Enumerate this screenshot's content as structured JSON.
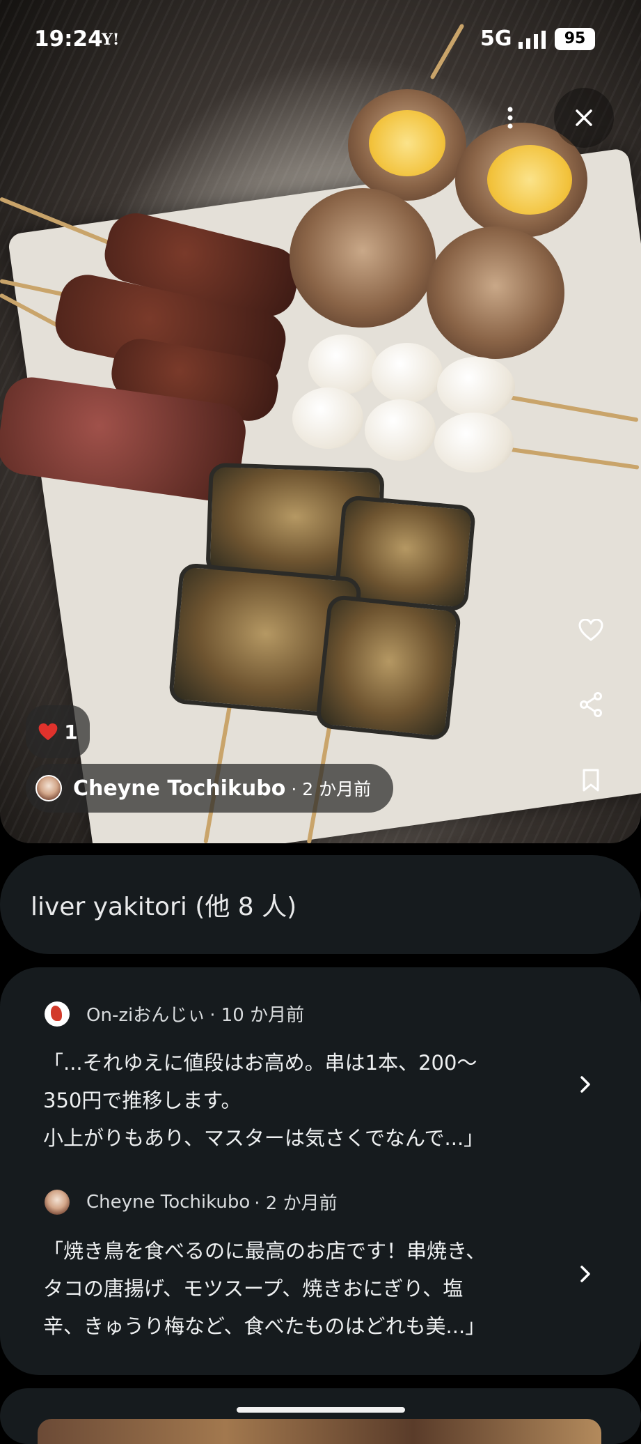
{
  "status_bar": {
    "time": "19:24",
    "carrier_icon": "Y!",
    "network": "5G",
    "battery": "95"
  },
  "photo": {
    "description_icon": "photo-of-yakitori",
    "like_count": "1",
    "author_name": "Cheyne Tochikubo",
    "author_meta": "· 2 か月前",
    "buttons": [
      "more-icon",
      "close-icon",
      "heart-icon",
      "share-icon",
      "bookmark-icon"
    ]
  },
  "caption": {
    "text": "liver yakitori (他 8 人)"
  },
  "reviews": [
    {
      "author": "On-ziおんじぃ",
      "meta": "· 10 か月前",
      "text": "「...それゆえに値段はお高め。串は1本、200〜\n350円で推移します。\n小上がりもあり、マスターは気さくでなんで...」"
    },
    {
      "author": "Cheyne Tochikubo",
      "meta": "· 2 か月前",
      "text": "「焼き鳥を食べるのに最高のお店です！串焼き、\nタコの唐揚げ、モツスープ、焼きおにぎり、塩\n辛、きゅうり梅など、食べたものはどれも美...」"
    }
  ]
}
